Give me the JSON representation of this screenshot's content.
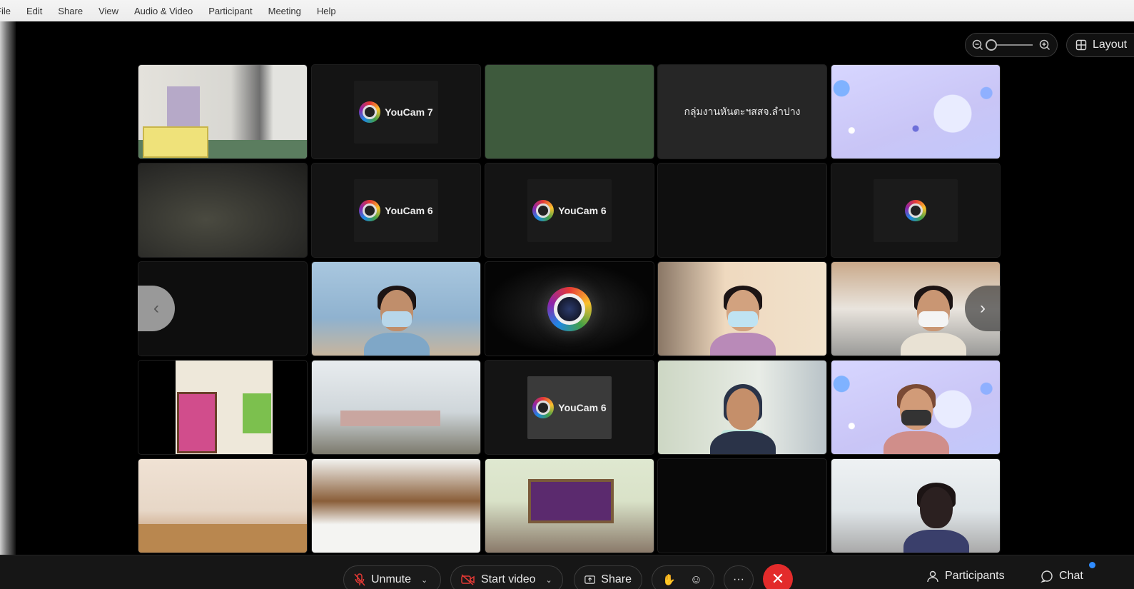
{
  "menu": [
    "File",
    "Edit",
    "Share",
    "View",
    "Audio & Video",
    "Participant",
    "Meeting",
    "Help"
  ],
  "top_controls": {
    "layout_label": "Layout",
    "zoom_level": 0
  },
  "tiles": {
    "r1c4_name": "กลุ่มงานหันตะฯสสจ.ลำปาง",
    "youcam7": "YouCam 7",
    "youcam6": "YouCam 6"
  },
  "toolbar": {
    "unmute": "Unmute",
    "start_video": "Start video",
    "share": "Share",
    "more": "···",
    "participants": "Participants",
    "chat": "Chat"
  },
  "colors": {
    "leave": "#e32b2b",
    "muted_icon": "#e53935",
    "notification_dot": "#2f8cff"
  }
}
